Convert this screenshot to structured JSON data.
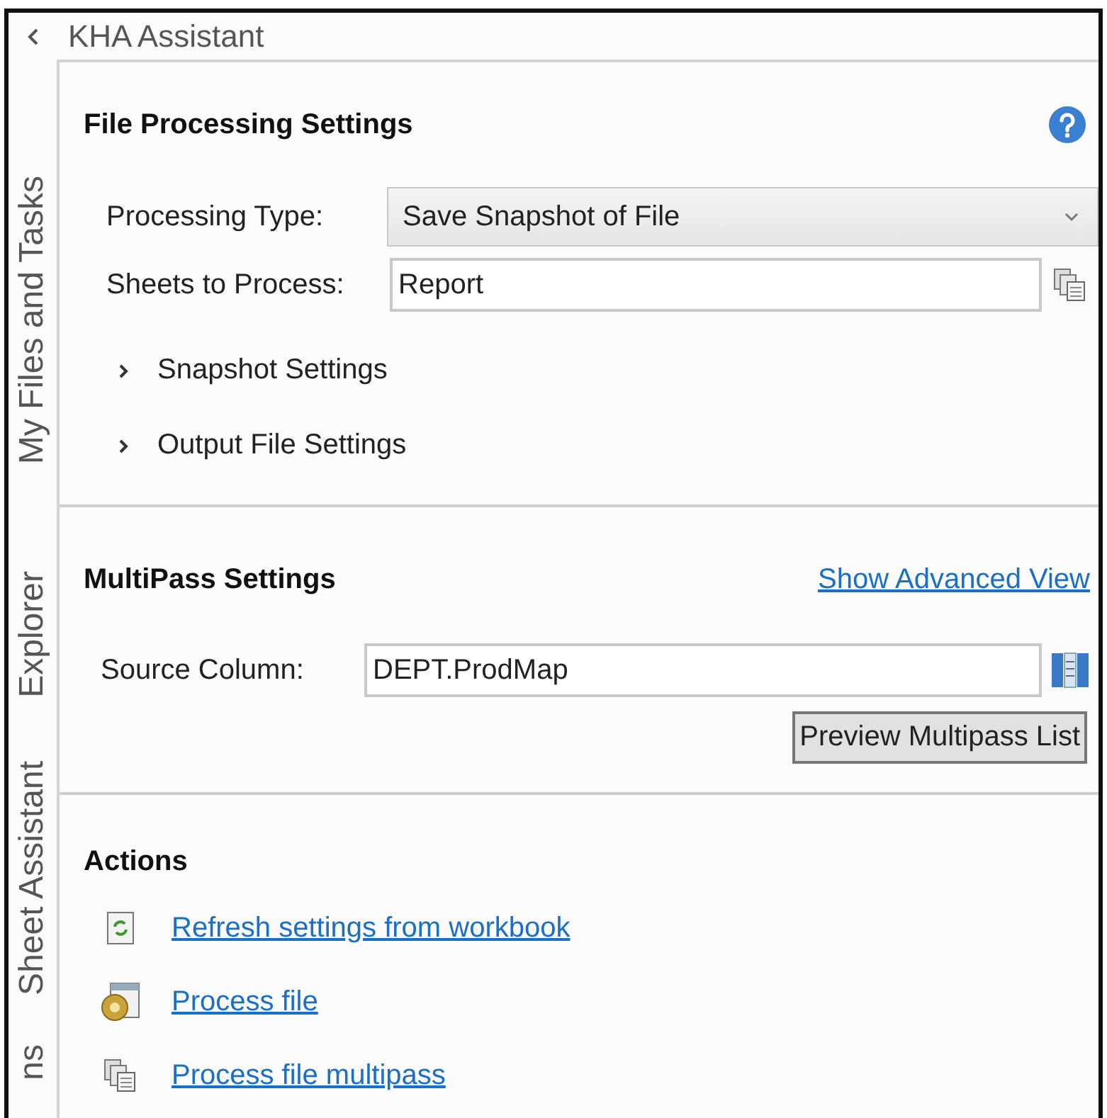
{
  "window": {
    "title": "KHA Assistant"
  },
  "sidebar": {
    "tabs": [
      {
        "label": "My Files and Tasks"
      },
      {
        "label": "Explorer"
      },
      {
        "label": "Sheet Assistant"
      },
      {
        "label": "ns"
      }
    ]
  },
  "file_processing": {
    "title": "File Processing Settings",
    "fields": [
      {
        "kind": "dropdown",
        "label": "Processing Type:",
        "value": "Save Snapshot of File"
      },
      {
        "kind": "text",
        "label": "Sheets to Process:",
        "value": "Report"
      }
    ],
    "expanders": [
      {
        "label": "Snapshot Settings",
        "expanded": false
      },
      {
        "label": "Output File Settings",
        "expanded": false
      }
    ]
  },
  "multipass": {
    "title": "MultiPass Settings",
    "link": "Show Advanced View",
    "source_column": {
      "label": "Source Column:",
      "value": "DEPT.ProdMap"
    },
    "button": "Preview Multipass List"
  },
  "actions": {
    "title": "Actions",
    "items": [
      {
        "kind": "refresh",
        "label": "Refresh settings from workbook"
      },
      {
        "kind": "process",
        "label": "Process file"
      },
      {
        "kind": "multipass",
        "label": "Process file multipass"
      }
    ]
  }
}
